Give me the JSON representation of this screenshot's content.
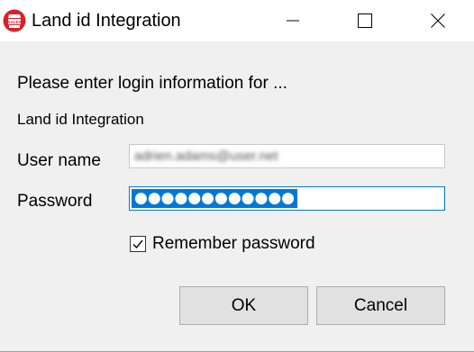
{
  "window": {
    "title": "Land id Integration",
    "icon": "sales-app-icon",
    "controls": [
      "minimize",
      "maximize",
      "close"
    ]
  },
  "dialog": {
    "prompt": "Please enter login information for ...",
    "service_name": "Land id Integration",
    "username_label": "User name",
    "username_value": "adrien.adams@user.net",
    "password_label": "Password",
    "password_value": "●●●●●●●●●●●●",
    "remember_label": "Remember password",
    "remember_checked": true,
    "ok_label": "OK",
    "cancel_label": "Cancel"
  },
  "colors": {
    "accent": "#0078d7",
    "dialog_bg": "#f0f0f0",
    "app_icon_red": "#d9222a"
  }
}
